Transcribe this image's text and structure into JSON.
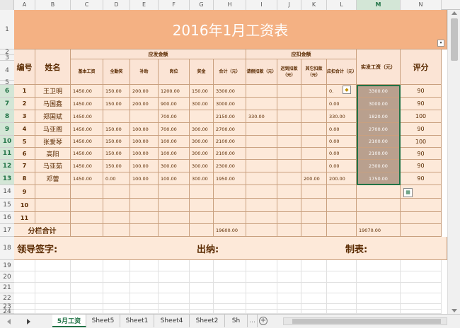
{
  "columns": [
    "A",
    "B",
    "C",
    "D",
    "E",
    "F",
    "G",
    "H",
    "I",
    "J",
    "K",
    "L",
    "M",
    "N"
  ],
  "rows_numbers": [
    "1",
    "2",
    "3",
    "4",
    "5",
    "6",
    "7",
    "8",
    "9",
    "10",
    "11",
    "12",
    "13",
    "14",
    "15",
    "16",
    "17",
    "18",
    "19",
    "20",
    "21",
    "22",
    "23",
    "24"
  ],
  "title": "2016年1月工资表",
  "header": {
    "no": "编号",
    "name": "姓名",
    "should_pay": "应发金额",
    "deduct": "应扣金额",
    "net_pay": "实发工资（元）",
    "rating": "评分",
    "sub": [
      "基本工资",
      "全勤奖",
      "补助",
      "岗位",
      "奖金",
      "合计（元）",
      "请假扣款（元）",
      "迟到扣款（元）",
      "其它扣款（元）",
      "应扣合计（元）"
    ]
  },
  "rows": [
    {
      "no": "1",
      "name": "王卫明",
      "c": "1450.00",
      "d": "150.00",
      "e": "200.00",
      "f": "1200.00",
      "g": "150.00",
      "h": "3300.00",
      "i": "",
      "j": "",
      "k": "",
      "l": "0.",
      "m": "3300.00",
      "n": "90"
    },
    {
      "no": "2",
      "name": "马国鑫",
      "c": "1450.00",
      "d": "150.00",
      "e": "200.00",
      "f": "900.00",
      "g": "300.00",
      "h": "3000.00",
      "i": "",
      "j": "",
      "k": "",
      "l": "0.00",
      "m": "3000.00",
      "n": "90"
    },
    {
      "no": "3",
      "name": "郑国斌",
      "c": "1450.00",
      "d": "",
      "e": "",
      "f": "700.00",
      "g": "",
      "h": "2150.00",
      "i": "330.00",
      "j": "",
      "k": "",
      "l": "330.00",
      "m": "1820.00",
      "n": "100"
    },
    {
      "no": "4",
      "name": "马亚阁",
      "c": "1450.00",
      "d": "150.00",
      "e": "100.00",
      "f": "700.00",
      "g": "300.00",
      "h": "2700.00",
      "i": "",
      "j": "",
      "k": "",
      "l": "0.00",
      "m": "2700.00",
      "n": "90"
    },
    {
      "no": "5",
      "name": "张爱琴",
      "c": "1450.00",
      "d": "150.00",
      "e": "100.00",
      "f": "100.00",
      "g": "300.00",
      "h": "2100.00",
      "i": "",
      "j": "",
      "k": "",
      "l": "0.00",
      "m": "2100.00",
      "n": "100"
    },
    {
      "no": "6",
      "name": "高阳",
      "c": "1450.00",
      "d": "150.00",
      "e": "100.00",
      "f": "100.00",
      "g": "300.00",
      "h": "2100.00",
      "i": "",
      "j": "",
      "k": "",
      "l": "0.00",
      "m": "2100.00",
      "n": "90"
    },
    {
      "no": "7",
      "name": "马亚茹",
      "c": "1450.00",
      "d": "150.00",
      "e": "100.00",
      "f": "300.00",
      "g": "300.00",
      "h": "2300.00",
      "i": "",
      "j": "",
      "k": "",
      "l": "0.00",
      "m": "2300.00",
      "n": "90"
    },
    {
      "no": "8",
      "name": "邓蕾",
      "c": "1450.00",
      "d": "0.00",
      "e": "100.00",
      "f": "100.00",
      "g": "300.00",
      "h": "1950.00",
      "i": "",
      "j": "",
      "k": "200.00",
      "l": "200.00",
      "m": "1750.00",
      "n": "90"
    },
    {
      "no": "9",
      "name": "",
      "c": "",
      "d": "",
      "e": "",
      "f": "",
      "g": "",
      "h": "",
      "i": "",
      "j": "",
      "k": "",
      "l": "",
      "m": "",
      "n": ""
    },
    {
      "no": "10",
      "name": "",
      "c": "",
      "d": "",
      "e": "",
      "f": "",
      "g": "",
      "h": "",
      "i": "",
      "j": "",
      "k": "",
      "l": "",
      "m": "",
      "n": ""
    },
    {
      "no": "11",
      "name": "",
      "c": "",
      "d": "",
      "e": "",
      "f": "",
      "g": "",
      "h": "",
      "i": "",
      "j": "",
      "k": "",
      "l": "",
      "m": "",
      "n": ""
    }
  ],
  "totals": {
    "label": "分栏合计",
    "h": "19600.00",
    "m": "19070.00"
  },
  "signatures": {
    "leader": "领导签字:",
    "cashier": "出纳:",
    "maker": "制表:"
  },
  "tabs": [
    "5月工资",
    "Sheet5",
    "Sheet1",
    "Sheet4",
    "Sheet2",
    "Sh"
  ],
  "colors": {
    "title_bg": "#f4b183",
    "header_bg": "#fbe4d5",
    "body_bg": "#fde9d9",
    "selection": "#b9a08e",
    "excel_green": "#217346"
  }
}
